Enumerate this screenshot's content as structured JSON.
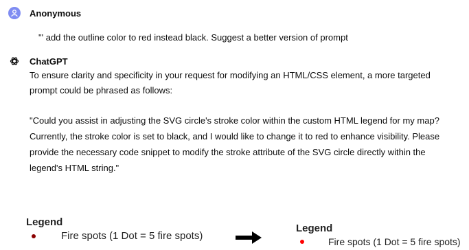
{
  "user_message": {
    "author": "Anonymous",
    "text": "\"' add the outline color to red instead black. Suggest a better version of prompt"
  },
  "assistant_message": {
    "author": "ChatGPT",
    "intro_line1": "To ensure clarity and specificity in your request for modifying an HTML/CSS element, a more targeted",
    "intro_line2": "prompt could be phrased as follows:",
    "quote_line1": "\"Could you assist in adjusting the SVG circle's stroke color within the custom HTML legend for my map?",
    "quote_line2": "Currently, the stroke color is set to black, and I would like to change it to red to enhance visibility. Please",
    "quote_line3": "provide the necessary code snippet to modify the stroke attribute of the SVG circle directly within the",
    "quote_line4": "legend's HTML string.\""
  },
  "legend_before": {
    "title": "Legend",
    "item": "Fire spots (1 Dot = 5 fire spots)",
    "dot_color": "#8b0000"
  },
  "legend_after": {
    "title": "Legend",
    "item": "Fire spots (1 Dot = 5 fire spots)",
    "dot_color": "#ff0000"
  },
  "arrow_icon": "right-arrow-icon",
  "colors": {
    "user_avatar": "#7f8cf2"
  }
}
